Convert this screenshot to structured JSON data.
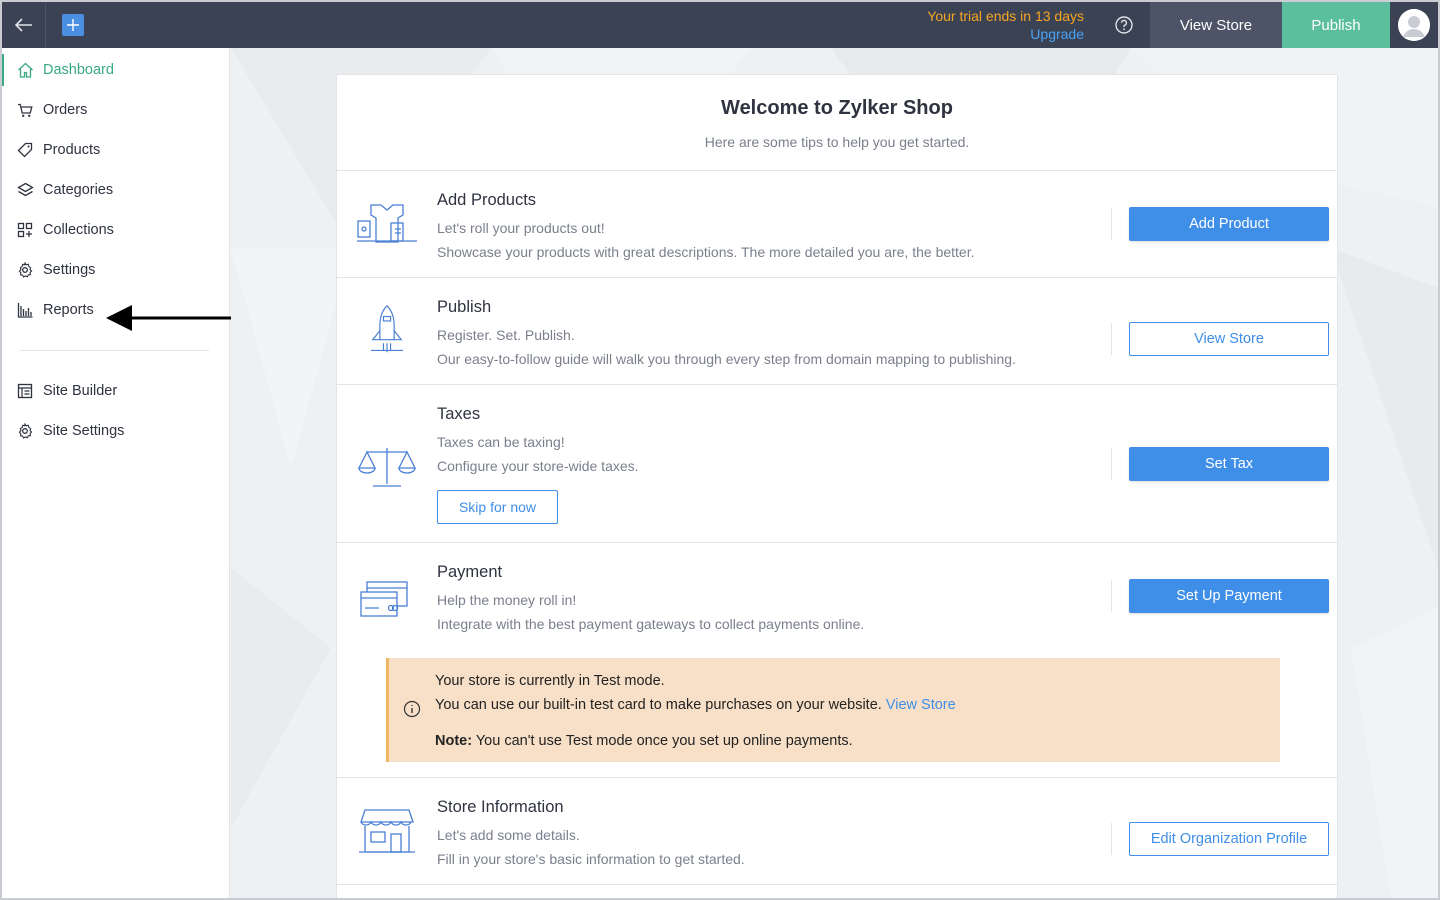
{
  "topbar": {
    "trial_text": "Your trial ends in 13 days",
    "upgrade_label": "Upgrade",
    "view_store_label": "View Store",
    "publish_label": "Publish"
  },
  "sidebar": {
    "items": [
      {
        "label": "Dashboard",
        "icon": "home-icon",
        "active": true
      },
      {
        "label": "Orders",
        "icon": "cart-icon"
      },
      {
        "label": "Products",
        "icon": "tag-icon"
      },
      {
        "label": "Categories",
        "icon": "layers-icon"
      },
      {
        "label": "Collections",
        "icon": "grid-plus-icon"
      },
      {
        "label": "Settings",
        "icon": "gear-icon"
      },
      {
        "label": "Reports",
        "icon": "bar-chart-icon"
      }
    ],
    "secondary": [
      {
        "label": "Site Builder",
        "icon": "site-builder-icon"
      },
      {
        "label": "Site Settings",
        "icon": "gear-icon"
      }
    ]
  },
  "welcome": {
    "title": "Welcome to Zylker Shop",
    "subtitle": "Here are some tips to help you get started."
  },
  "sections": {
    "add_products": {
      "title": "Add Products",
      "line1": "Let's roll your products out!",
      "line2": "Showcase your products with great descriptions. The more detailed you are, the better.",
      "button": "Add Product"
    },
    "publish": {
      "title": "Publish",
      "line1": "Register. Set. Publish.",
      "line2": "Our easy-to-follow guide will walk you through every step from domain mapping to publishing.",
      "button": "View Store"
    },
    "taxes": {
      "title": "Taxes",
      "line1": "Taxes can be taxing!",
      "line2": "Configure your store-wide taxes.",
      "skip": "Skip for now",
      "button": "Set Tax"
    },
    "payment": {
      "title": "Payment",
      "line1": "Help the money roll in!",
      "line2": "Integrate with the best payment gateways to collect payments online.",
      "button": "Set Up Payment",
      "notice": {
        "line1": "Your store is currently in Test mode.",
        "line2": "You can use our built-in test card to make purchases on your website.",
        "link": "View Store",
        "note_label": "Note:",
        "note_text": "You can't use Test mode once you set up online payments."
      }
    },
    "store_info": {
      "title": "Store Information",
      "line1": "Let's add some details.",
      "line2": "Fill in your store's basic information to get started.",
      "button": "Edit Organization Profile"
    }
  },
  "colors": {
    "topbar": "#3b4254",
    "publish": "#5bbf9e",
    "primary": "#3f8ee8",
    "active_nav": "#3aa981",
    "trial": "#f5a623",
    "notice_bg": "#f8e0c8"
  }
}
